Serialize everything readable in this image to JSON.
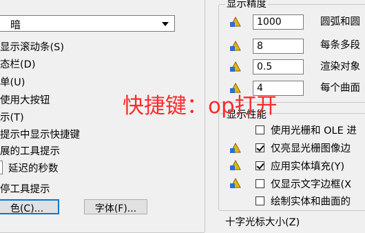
{
  "left_panel": {
    "dropdown_value": "暗",
    "options": [
      "显示滚动条(S)",
      "态栏(D)",
      "单(U)",
      "使用大按钮",
      "示(T)",
      "提示中显示快捷键",
      "展的工具提示",
      "延迟的秒数",
      "停工具提示"
    ],
    "color_button": "色(C)...",
    "font_button": "字体(F)..."
  },
  "display_precision": {
    "title": "显示精度",
    "rows": [
      {
        "value": "1000",
        "label": "圆弧和圆"
      },
      {
        "value": "8",
        "label": "每条多段"
      },
      {
        "value": "0.5",
        "label": "渲染对象"
      },
      {
        "value": "4",
        "label": "每个曲面"
      }
    ]
  },
  "display_performance": {
    "title": "显示性能",
    "items": [
      {
        "label": "使用光栅和 OLE 进",
        "checked": false
      },
      {
        "label": "仅亮显光栅图像边",
        "checked": true
      },
      {
        "label": "应用实体填充(Y)",
        "checked": true
      },
      {
        "label": "仅显示文字边框(X",
        "checked": false
      },
      {
        "label": "绘制实体和曲面的",
        "checked": false
      }
    ]
  },
  "bottom_partial_label": "十字光标大小(Z)",
  "overlay_text": "快捷键：op打开",
  "colors": {
    "overlay": "#ff2b2b",
    "background": "#f0f0f0",
    "button_focus": "#0078d7"
  }
}
